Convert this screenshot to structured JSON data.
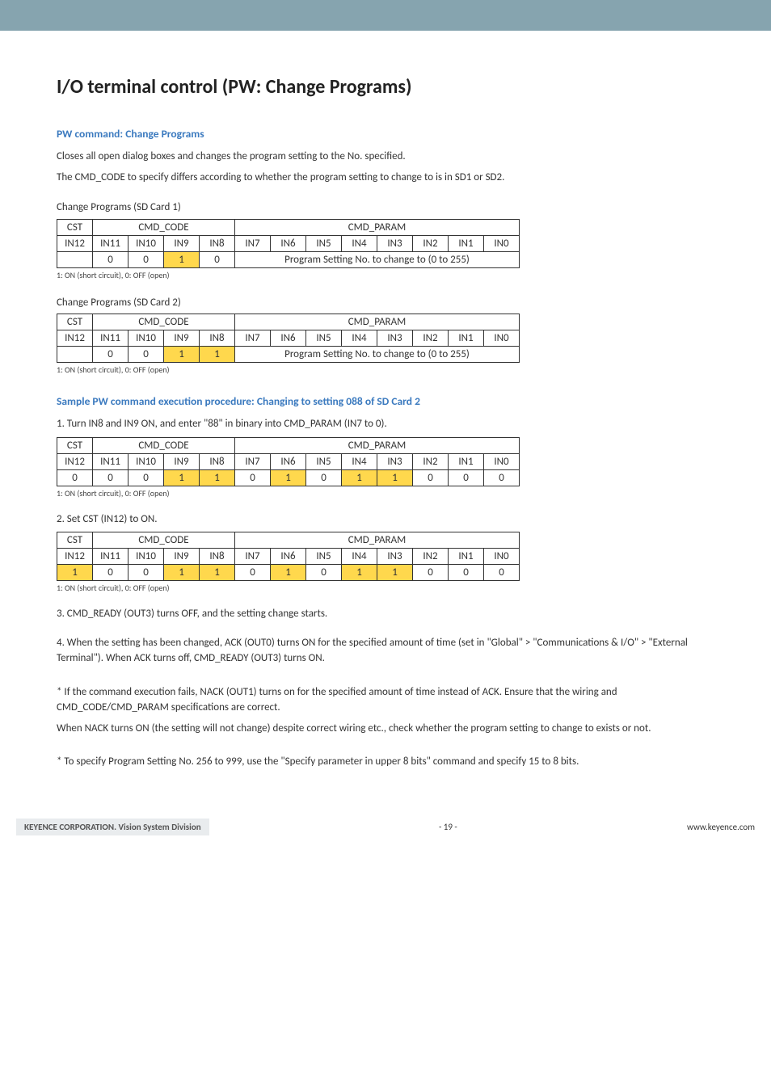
{
  "title": "I/O terminal control (PW: Change Programs)",
  "section1_heading": "PW command: Change Programs",
  "section1_p1": "Closes all open dialog boxes and changes the program setting to the No. specified.",
  "section1_p2": "The CMD_CODE to specify differs according to whether the program setting to change to is in SD1 or SD2.",
  "table1_caption": "Change Programs (SD Card 1)",
  "table2_caption": "Change Programs (SD Card 2)",
  "note": "1: ON (short circuit), 0: OFF (open)",
  "headers": {
    "cst": "CST",
    "cmd_code": "CMD_CODE",
    "cmd_param": "CMD_PARAM",
    "cols": [
      "IN12",
      "IN11",
      "IN10",
      "IN9",
      "IN8",
      "IN7",
      "IN6",
      "IN5",
      "IN4",
      "IN3",
      "IN2",
      "IN1",
      "IN0"
    ]
  },
  "param_msg": "Program Setting No. to change to (0 to 255)",
  "table1_row": {
    "in12": "",
    "in11": "0",
    "in10": "0",
    "in9": "1",
    "in8": "0"
  },
  "table2_row": {
    "in12": "",
    "in11": "0",
    "in10": "0",
    "in9": "1",
    "in8": "1"
  },
  "section2_heading": "Sample PW command execution procedure: Changing to setting 088 of SD Card 2",
  "step1": "1. Turn IN8 and IN9 ON, and enter \"88\" in binary into CMD_PARAM (IN7 to 0).",
  "table3_row": [
    "0",
    "0",
    "0",
    "1",
    "1",
    "0",
    "1",
    "0",
    "1",
    "1",
    "0",
    "0",
    "0"
  ],
  "step2": "2. Set CST (IN12) to ON.",
  "table4_row": [
    "1",
    "0",
    "0",
    "1",
    "1",
    "0",
    "1",
    "0",
    "1",
    "1",
    "0",
    "0",
    "0"
  ],
  "step3": "3. CMD_READY (OUT3) turns OFF, and the setting change starts.",
  "step4": "4. When the setting has been changed, ACK (OUT0) turns ON for the specified amount of time (set in \"Global\" > \"Communications & I/O\" > \"External Terminal\"). When ACK turns off, CMD_READY (OUT3) turns ON.",
  "step5": "* If the command execution fails, NACK (OUT1) turns on for the specified amount of time instead of ACK. Ensure that the wiring and CMD_CODE/CMD_PARAM specifications are correct.",
  "step6": "When NACK turns ON (the setting will not change) despite correct wiring etc., check whether the program setting to change to exists or not.",
  "step7": "* To specify Program Setting No. 256 to 999, use the \"Specify parameter in upper 8 bits\" command and specify 15 to 8 bits.",
  "footer_left": "KEYENCE CORPORATION. Vision System Division",
  "footer_center": "- 19 -",
  "footer_right": "www.keyence.com",
  "chart_data": [
    {
      "type": "table",
      "title": "Change Programs (SD Card 1)",
      "columns": [
        "IN12",
        "IN11",
        "IN10",
        "IN9",
        "IN8",
        "IN7",
        "IN6",
        "IN5",
        "IN4",
        "IN3",
        "IN2",
        "IN1",
        "IN0"
      ],
      "cmd_code": [
        null,
        0,
        0,
        1,
        0
      ],
      "cmd_param_text": "Program Setting No. to change to (0 to 255)"
    },
    {
      "type": "table",
      "title": "Change Programs (SD Card 2)",
      "columns": [
        "IN12",
        "IN11",
        "IN10",
        "IN9",
        "IN8",
        "IN7",
        "IN6",
        "IN5",
        "IN4",
        "IN3",
        "IN2",
        "IN1",
        "IN0"
      ],
      "cmd_code": [
        null,
        0,
        0,
        1,
        1
      ],
      "cmd_param_text": "Program Setting No. to change to (0 to 255)"
    },
    {
      "type": "table",
      "title": "Sample step 1",
      "columns": [
        "IN12",
        "IN11",
        "IN10",
        "IN9",
        "IN8",
        "IN7",
        "IN6",
        "IN5",
        "IN4",
        "IN3",
        "IN2",
        "IN1",
        "IN0"
      ],
      "values": [
        0,
        0,
        0,
        1,
        1,
        0,
        1,
        0,
        1,
        1,
        0,
        0,
        0
      ]
    },
    {
      "type": "table",
      "title": "Sample step 2",
      "columns": [
        "IN12",
        "IN11",
        "IN10",
        "IN9",
        "IN8",
        "IN7",
        "IN6",
        "IN5",
        "IN4",
        "IN3",
        "IN2",
        "IN1",
        "IN0"
      ],
      "values": [
        1,
        0,
        0,
        1,
        1,
        0,
        1,
        0,
        1,
        1,
        0,
        0,
        0
      ]
    }
  ]
}
